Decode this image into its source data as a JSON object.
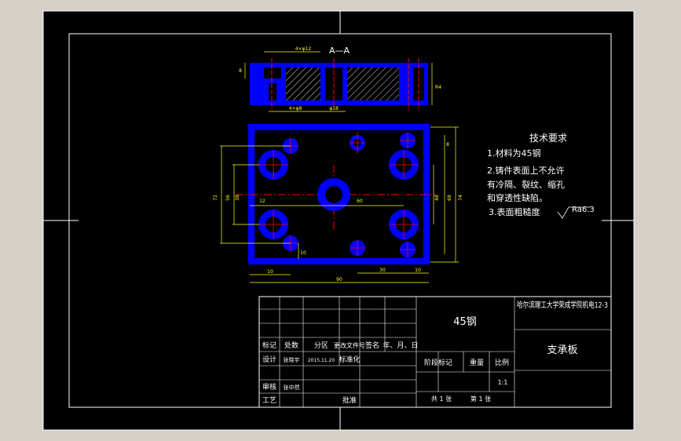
{
  "section_label": "A—A",
  "tech_requirements": {
    "title": "技术要求",
    "items": [
      "1.材料为45钢",
      "2.铸件表面上不允许",
      "有冷隔、裂纹、缩孔",
      "和穿透性缺陷。",
      "3.表面粗糙度"
    ],
    "roughness": "Ra6.3"
  },
  "dimensions": {
    "top_a": "4×φ12",
    "top_b": "4×φ8",
    "top_c": "φ18",
    "top_right": "R4",
    "top_left": "8",
    "left_outer": "72",
    "left_mid": "56",
    "left_inner": "38",
    "right_outer": "74",
    "right_mid": "68",
    "right_inner": "48",
    "right_small": "8",
    "center_left": "12",
    "center_mid": "60",
    "bottom_small": "10",
    "bottom_left": "10",
    "bottom_total": "90",
    "bottom_right_a": "30",
    "bottom_right_b": "10"
  },
  "title_block": {
    "material": "45钢",
    "school": "哈尔滨理工大学荣成学院机电12-3",
    "part_name": "支承板",
    "scale": "1:1",
    "h_mark": "标记",
    "h_count": "处数",
    "h_zone": "分区",
    "h_doc": "更改文件号",
    "h_sign": "签名",
    "h_date": "年、月、日",
    "h_design": "设计",
    "designer": "张晓宇",
    "design_date": "2015.11.20",
    "h_std": "标准化",
    "h_stage": "阶段标记",
    "h_weight": "重量",
    "h_scale": "比例",
    "h_review": "审核",
    "reviewer": "张中然",
    "h_process": "工艺",
    "h_approve": "批准",
    "sheets_total": "共 1 张",
    "sheet_no": "第 1 张"
  },
  "colors": {
    "paper": "#000000",
    "frame": "#ffffff",
    "part": "#0000ff",
    "center_line": "#ff0000",
    "dimension": "#ffff00",
    "text": "#ffffff"
  }
}
